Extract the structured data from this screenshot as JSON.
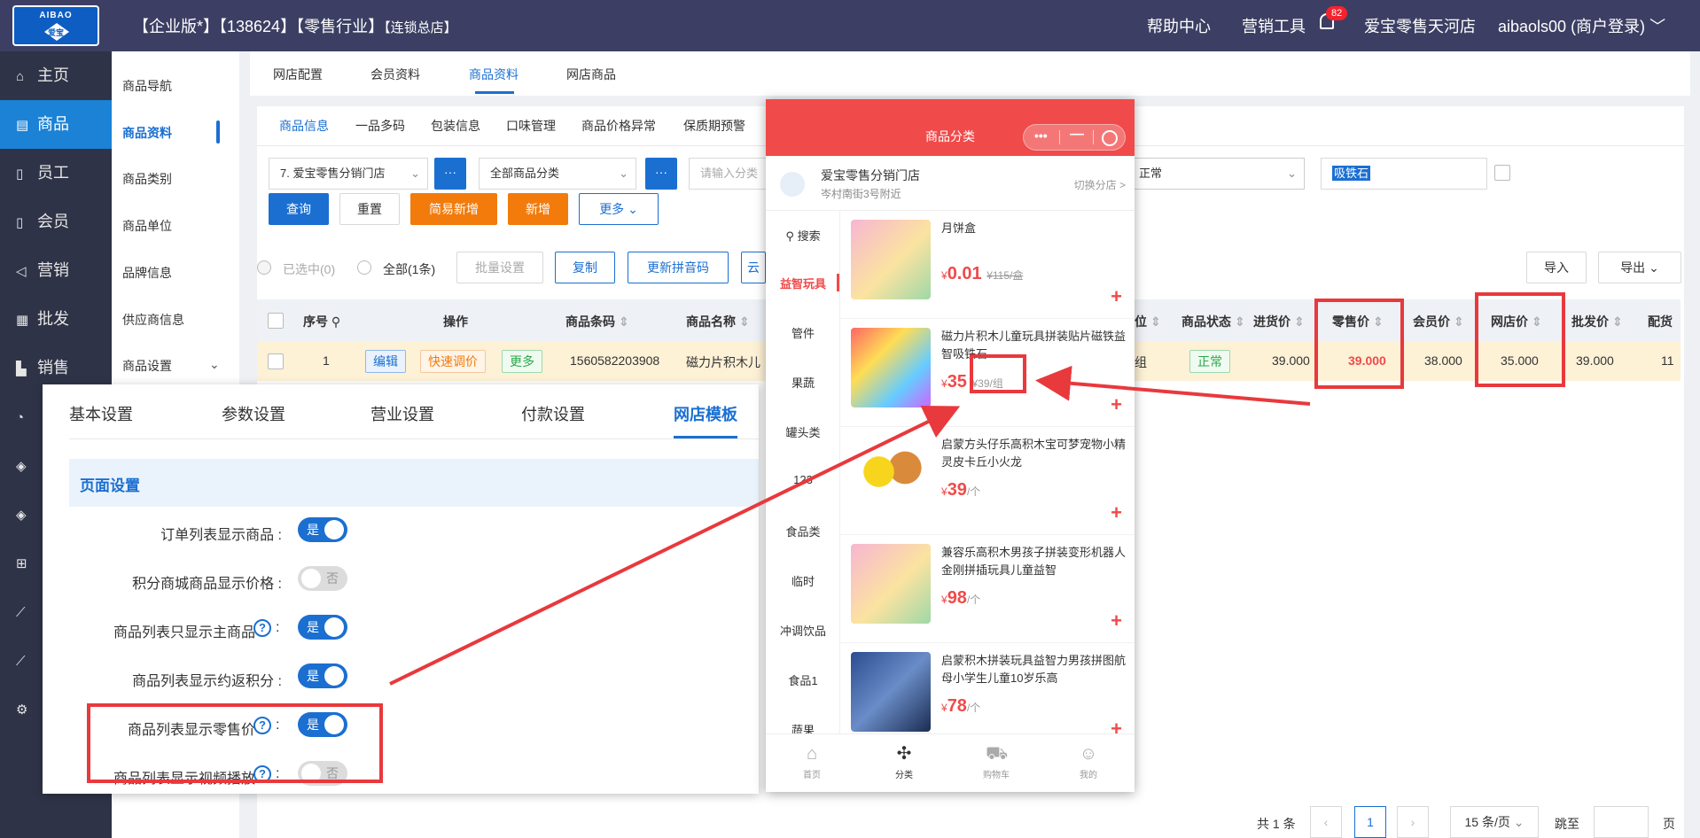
{
  "header": {
    "logo_top": "AIBAO",
    "logo_bottom": "爱宝",
    "title_main": "【企业版*】【138624】【零售行业】",
    "title_small": "【连锁总店】",
    "help": "帮助中心",
    "tools": "营销工具",
    "notif_count": "82",
    "store": "爱宝零售天河店",
    "user": "aibaols00 (商户登录)"
  },
  "leftnav": {
    "items": [
      {
        "label": "主页",
        "icon": "home-icon"
      },
      {
        "label": "商品",
        "icon": "goods-icon"
      },
      {
        "label": "员工",
        "icon": "staff-icon"
      },
      {
        "label": "会员",
        "icon": "member-icon"
      },
      {
        "label": "营销",
        "icon": "marketing-icon"
      },
      {
        "label": "批发",
        "icon": "wholesale-icon"
      },
      {
        "label": "销售",
        "icon": "sales-icon"
      }
    ]
  },
  "subnav": {
    "items": [
      "商品导航",
      "商品资料",
      "商品类别",
      "商品单位",
      "品牌信息",
      "供应商信息",
      "商品设置"
    ]
  },
  "toptabs": [
    "网店配置",
    "会员资料",
    "商品资料",
    "网店商品"
  ],
  "subtabs": [
    "商品信息",
    "一品多码",
    "包装信息",
    "口味管理",
    "商品价格异常",
    "保质期预警"
  ],
  "filters": {
    "store": "7. 爱宝零售分销门店",
    "category": "全部商品分类",
    "search_placeholder": "请输入分类",
    "status": "正常",
    "keyword": "吸铁石",
    "dots": "···"
  },
  "buttons": {
    "query": "查询",
    "reset": "重置",
    "quick_add": "简易新增",
    "add": "新增",
    "more": "更多",
    "import": "导入",
    "export": "导出",
    "batch": "批量设置",
    "copy": "复制",
    "update_pinyin": "更新拼音码",
    "cloud": "云"
  },
  "selection": {
    "selected": "已选中(0)",
    "all": "全部(1条)"
  },
  "table": {
    "headers": [
      "序号",
      "操作",
      "商品条码",
      "商品名称",
      "位",
      "商品状态",
      "进货价",
      "零售价",
      "会员价",
      "网店价",
      "批发价",
      "配货"
    ],
    "row": {
      "index": "1",
      "edit": "编辑",
      "quick_price": "快速调价",
      "more": "更多",
      "barcode": "1560582203908",
      "name": "磁力片积木儿",
      "unit": "组",
      "status": "正常",
      "purchase": "39.000",
      "retail": "39.000",
      "member": "38.000",
      "online": "35.000",
      "wholesale": "39.000",
      "dist": "11"
    }
  },
  "pager": {
    "total": "共 1 条",
    "page": "1",
    "per_page": "15 条/页",
    "goto": "跳至",
    "page_unit": "页"
  },
  "settings": {
    "tabs": [
      "基本设置",
      "参数设置",
      "营业设置",
      "付款设置",
      "网店模板"
    ],
    "section": "页面设置",
    "rows": [
      {
        "label": "订单列表显示商品 :",
        "value": "是",
        "on": true,
        "help": false
      },
      {
        "label": "积分商城商品显示价格 :",
        "value": "否",
        "on": false,
        "help": false
      },
      {
        "label": "商品列表只显示主商品",
        "value": "是",
        "on": true,
        "help": true
      },
      {
        "label": "商品列表显示约返积分 :",
        "value": "是",
        "on": true,
        "help": false
      },
      {
        "label": "商品列表显示零售价",
        "value": "是",
        "on": true,
        "help": true
      },
      {
        "label": "商品列表显示视频播放",
        "value": "否",
        "on": false,
        "help": true
      }
    ]
  },
  "phone": {
    "title": "商品分类",
    "store_name": "爱宝零售分销门店",
    "store_addr": "岑村南街3号附近",
    "switch": "切换分店 >",
    "search": "搜索",
    "categories": [
      "益智玩具",
      "管件",
      "果蔬",
      "罐头类",
      "123",
      "食品类",
      "临时",
      "冲调饮品",
      "食品1",
      "蔬果"
    ],
    "products": [
      {
        "name": "月饼盒",
        "price": "0.01",
        "old": "¥115/盒",
        "unit": ""
      },
      {
        "name": "磁力片积木儿童玩具拼装贴片磁铁益智吸铁石",
        "price": "35",
        "old": "¥39/组",
        "unit": ""
      },
      {
        "name": "启蒙方头仔乐高积木宝可梦宠物小精灵皮卡丘小火龙",
        "price": "39",
        "old": "",
        "unit": "/个"
      },
      {
        "name": "兼容乐高积木男孩子拼装变形机器人金刚拼插玩具儿童益智",
        "price": "98",
        "old": "",
        "unit": "/个"
      },
      {
        "name": "启蒙积木拼装玩具益智力男孩拼图航母小学生儿童10岁乐高",
        "price": "78",
        "old": "",
        "unit": "/个"
      }
    ],
    "currency": "¥",
    "plus": "+",
    "tabbar": [
      "首页",
      "分类",
      "购物车",
      "我的"
    ]
  },
  "colors": {
    "header_bg": "#3c3f63",
    "nav_bg": "#2f3347",
    "accent": "#1b6fd1",
    "orange": "#f27b0c",
    "phone_red": "#f04a4a",
    "annotation_red": "#e8393d"
  }
}
